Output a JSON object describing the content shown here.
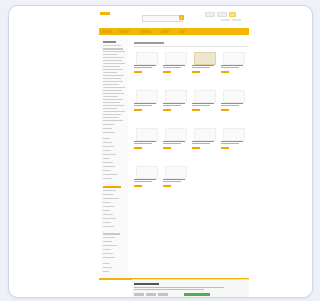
{
  "search": {
    "placeholder": ""
  },
  "navbar": {
    "items": [
      "",
      "",
      "",
      "",
      ""
    ]
  },
  "sidebar": {
    "sections": 6
  },
  "main": {
    "section_title": "",
    "products": [
      {
        "title": "",
        "subtitle": "",
        "price": ""
      },
      {
        "title": "",
        "subtitle": "",
        "price": ""
      },
      {
        "title": "",
        "subtitle": "",
        "price": ""
      },
      {
        "title": "",
        "subtitle": "",
        "price": ""
      },
      {
        "title": "",
        "subtitle": "",
        "price": ""
      },
      {
        "title": "",
        "subtitle": "",
        "price": ""
      },
      {
        "title": "",
        "subtitle": "",
        "price": ""
      },
      {
        "title": "",
        "subtitle": "",
        "price": ""
      },
      {
        "title": "",
        "subtitle": "",
        "price": ""
      },
      {
        "title": "",
        "subtitle": "",
        "price": ""
      },
      {
        "title": "",
        "subtitle": "",
        "price": ""
      },
      {
        "title": "",
        "subtitle": "",
        "price": ""
      },
      {
        "title": "",
        "subtitle": "",
        "price": ""
      },
      {
        "title": "",
        "subtitle": "",
        "price": ""
      }
    ]
  },
  "cookie_banner": {
    "title": "",
    "text": "",
    "buttons": [
      "",
      "",
      "",
      ""
    ]
  },
  "colors": {
    "accent": "#f2b705",
    "price": "#f2a600",
    "accept": "#4caf50",
    "background": "#eef2f8"
  },
  "icons": {
    "search_button": "search-icon"
  }
}
